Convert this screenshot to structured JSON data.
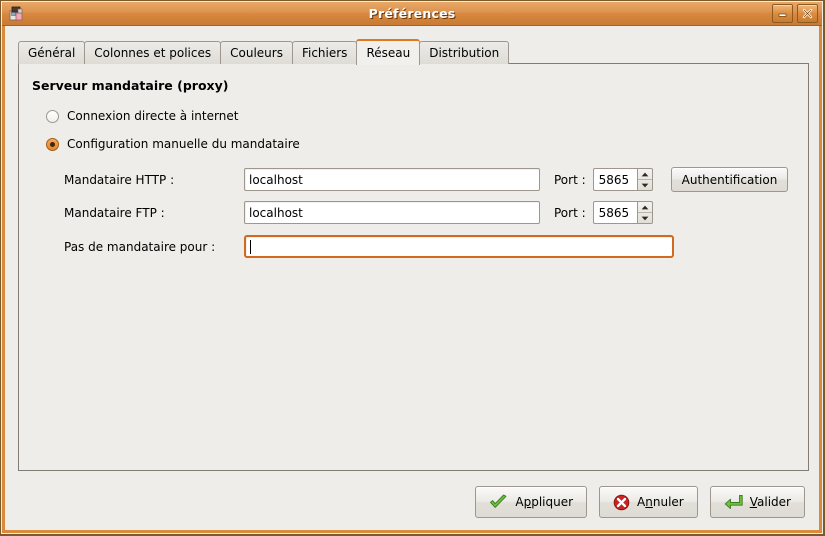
{
  "window": {
    "title": "Préférences",
    "icon": "package-icon",
    "minimize_label": "_",
    "close_label": "x",
    "accent_color": "#d98a3d",
    "frame_border_color": "#7a5a2a",
    "background_color": "#efedea"
  },
  "tabs": [
    {
      "label": "Général",
      "active": false
    },
    {
      "label": "Colonnes et polices",
      "active": false
    },
    {
      "label": "Couleurs",
      "active": false
    },
    {
      "label": "Fichiers",
      "active": false
    },
    {
      "label": "Réseau",
      "active": true
    },
    {
      "label": "Distribution",
      "active": false
    }
  ],
  "panel": {
    "section_title": "Serveur mandataire (proxy)",
    "radios": [
      {
        "label": "Connexion directe à internet",
        "selected": false
      },
      {
        "label": "Configuration manuelle du mandataire",
        "selected": true
      }
    ],
    "http": {
      "label": "Mandataire HTTP :",
      "value": "localhost",
      "port_label": "Port :",
      "port_value": "5865",
      "auth_button": "Authentification"
    },
    "ftp": {
      "label": "Mandataire FTP :",
      "value": "localhost",
      "port_label": "Port :",
      "port_value": "5865"
    },
    "no_proxy": {
      "label": "Pas de mandataire pour :",
      "value": "",
      "focused": true,
      "focus_color": "#d2691e"
    }
  },
  "actions": {
    "apply": {
      "label_pre": "A",
      "label_key": "p",
      "label_post": "pliquer",
      "icon": "check-icon",
      "icon_color": "#5fb339"
    },
    "cancel": {
      "label_pre": "A",
      "label_key": "n",
      "label_post": "nuler",
      "icon": "error-x-icon",
      "icon_color": "#cc2222"
    },
    "validate": {
      "label_pre": "",
      "label_key": "V",
      "label_post": "alider",
      "icon": "enter-arrow-icon",
      "icon_color": "#5fb339"
    }
  }
}
